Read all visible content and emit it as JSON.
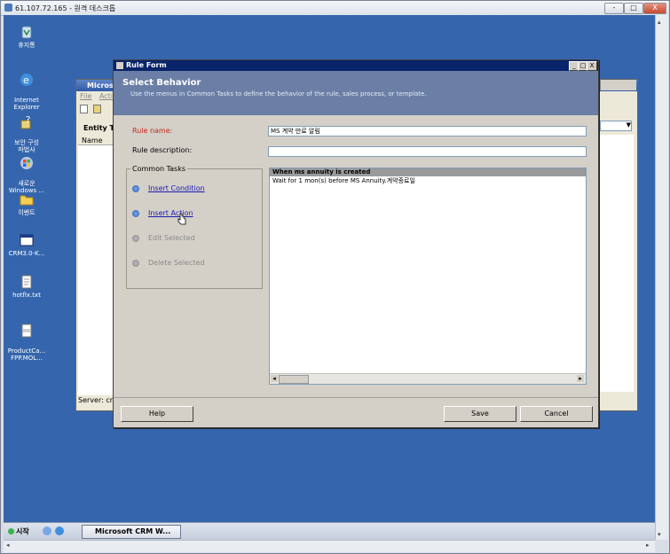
{
  "remote_desktop": {
    "title": "61.107.72.165 - 원격 데스크톱",
    "minimize": "-",
    "restore": "□",
    "close": "X"
  },
  "desktop_icons": [
    {
      "label": "휴지통",
      "icon": "recycle-bin-icon"
    },
    {
      "label": "Internet\nExplorer",
      "icon": "internet-explorer-icon"
    },
    {
      "label": "보안 구성\n마법사",
      "icon": "security-wizard-icon"
    },
    {
      "label": "새로운\nWindows ...",
      "icon": "windows-icon"
    },
    {
      "label": "이벤트",
      "icon": "folder-icon"
    },
    {
      "label": "CRM3.0-K...",
      "icon": "window-icon"
    },
    {
      "label": "hotfix.txt",
      "icon": "text-file-icon"
    },
    {
      "label": "ProductCa...\nFPP.MOL...",
      "icon": "document-icon"
    }
  ],
  "background_window": {
    "title": "Micros",
    "menu": [
      "File",
      "Actio"
    ],
    "entity_label": "Entity Ty",
    "name_col": "Name",
    "status": "Server: crm"
  },
  "dialog": {
    "title": "Rule Form",
    "header_title": "Select Behavior",
    "header_desc": "Use the menus in Common Tasks to define the behavior of the rule, sales process, or template.",
    "rule_name_label": "Rule name:",
    "rule_name_value": "MS 계약 만료 알림",
    "rule_desc_label": "Rule description:",
    "rule_desc_value": "",
    "common_tasks_label": "Common Tasks",
    "tasks": [
      {
        "label": "Insert Condition",
        "enabled": true
      },
      {
        "label": "Insert Action",
        "enabled": true
      },
      {
        "label": "Edit Selected",
        "enabled": false
      },
      {
        "label": "Delete Selected",
        "enabled": false
      }
    ],
    "behavior_header": "When ms annuity is created",
    "behavior_row": "Wait for 1 mon(s) before MS Annuity.계약종료일",
    "help_button": "Help",
    "save_button": "Save",
    "cancel_button": "Cancel"
  },
  "taskbar": {
    "start_label": "시작",
    "task_item": "Microsoft CRM W..."
  }
}
